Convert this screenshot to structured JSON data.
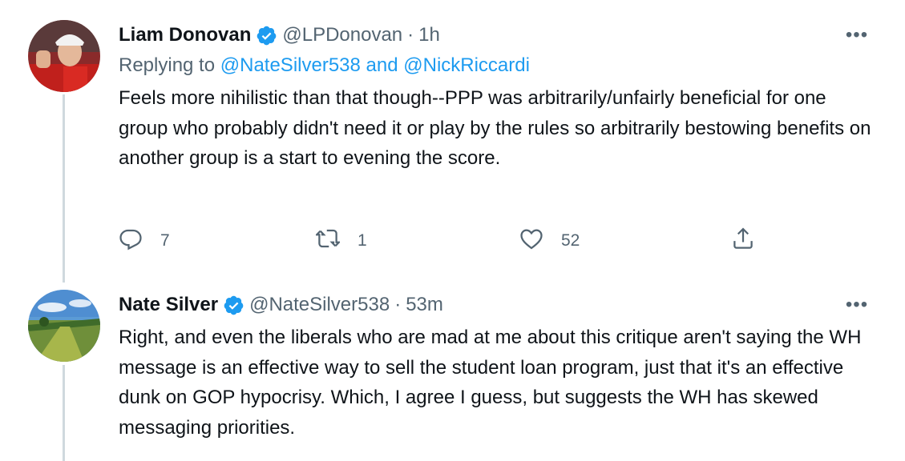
{
  "tweets": [
    {
      "name": "Liam Donovan",
      "handle": "@LPDonovan",
      "separator": "·",
      "time": "1h",
      "replying_prefix": "Replying to",
      "replying_to": "@NateSilver538 and @NickRiccardi",
      "text": "Feels more nihilistic than that though--PPP was arbitrarily/unfairly beneficial for one group who probably didn't need it or play by the rules so arbitrarily bestowing benefits on another group is a start to evening the score.",
      "more_label": "•••",
      "replies": "7",
      "retweets": "1",
      "likes": "52"
    },
    {
      "name": "Nate Silver",
      "handle": "@NateSilver538",
      "separator": "·",
      "time": "53m",
      "text": "Right, and even the liberals who are mad at me about this critique aren't saying the WH message is an effective way to sell the student loan program, just that it's an effective dunk on GOP hypocrisy. Which, I agree I guess, but suggests the WH has skewed messaging priorities.",
      "more_label": "•••"
    }
  ],
  "icons": [
    "verified-badge-icon",
    "reply-icon",
    "retweet-icon",
    "like-icon",
    "share-icon",
    "more-icon"
  ],
  "colors": {
    "accent": "#1d9bf0",
    "secondary_text": "#536471",
    "thread_line": "#cfd9de"
  }
}
